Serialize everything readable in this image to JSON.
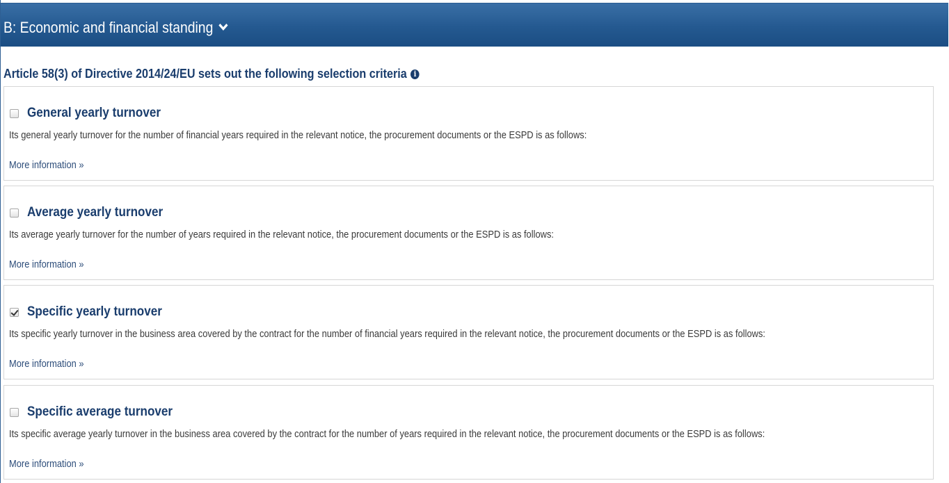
{
  "panel": {
    "title": "B: Economic and financial standing",
    "chevron_icon": "chevron-down-icon",
    "header_color": "#245990"
  },
  "section": {
    "heading": "Article 58(3) of Directive 2014/24/EU sets out the following selection criteria",
    "info_icon": "info-circle-icon"
  },
  "criteria": [
    {
      "title": "General yearly turnover",
      "checked": false,
      "description": "Its general yearly turnover for the number of financial years required in the relevant notice, the procurement documents or the ESPD is as follows:",
      "more_link": "More information »"
    },
    {
      "title": "Average yearly turnover",
      "checked": false,
      "description": "Its average yearly turnover for the number of years required in the relevant notice, the procurement documents or the ESPD is as follows:",
      "more_link": "More information »"
    },
    {
      "title": "Specific yearly turnover",
      "checked": true,
      "description": "Its specific yearly turnover in the business area covered by the contract for the number of financial years required in the relevant notice, the procurement documents or the ESPD is as follows:",
      "more_link": "More information »"
    },
    {
      "title": "Specific average turnover",
      "checked": false,
      "description": "Its specific average yearly turnover in the business area covered by the contract for the number of years required in the relevant notice, the procurement documents or the ESPD is as follows:",
      "more_link": "More information »"
    }
  ]
}
